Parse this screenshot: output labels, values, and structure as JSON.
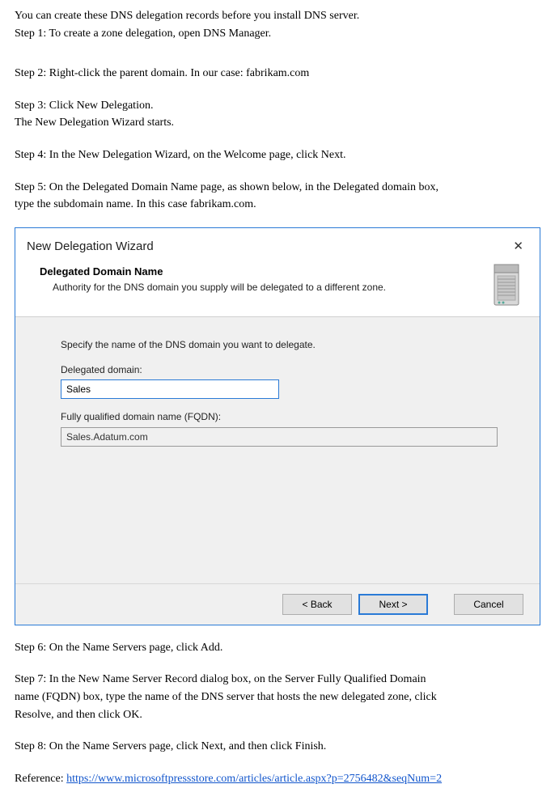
{
  "doc": {
    "intro_line1": "You can create these DNS delegation records before you install DNS server.",
    "step1": "Step 1: To create a zone delegation, open DNS Manager.",
    "step2": "Step 2: Right-click the parent domain. In our case: fabrikam.com",
    "step3a": "Step 3: Click New Delegation.",
    "step3b": "The New Delegation Wizard starts.",
    "step4": "Step 4: In the New Delegation Wizard, on the Welcome page, click Next.",
    "step5a": "Step 5: On the Delegated Domain Name page, as shown below, in the Delegated domain box,",
    "step5b": "type the subdomain name. In this case fabrikam.com.",
    "step6": "Step 6: On the Name Servers page, click Add.",
    "step7a": "Step 7: In the New Name Server Record dialog box, on the Server Fully Qualified Domain",
    "step7b": "name (FQDN) box, type the name of the DNS server that hosts the new delegated zone, click",
    "step7c": "Resolve, and then click OK.",
    "step8": "Step 8: On the Name Servers page, click Next, and then click Finish.",
    "ref_label": "Reference: ",
    "ref_url": "https://www.microsoftpressstore.com/articles/article.aspx?p=2756482&seqNum=2"
  },
  "wizard": {
    "title": "New Delegation Wizard",
    "close": "✕",
    "heading": "Delegated Domain Name",
    "sub": "Authority for the DNS domain you supply will be delegated to a different zone.",
    "instruction": "Specify the name of the DNS domain you want to delegate.",
    "delegated_label": "Delegated domain:",
    "delegated_value": "Sales",
    "fqdn_label": "Fully qualified domain name (FQDN):",
    "fqdn_value": "Sales.Adatum.com",
    "back": "< Back",
    "next": "Next >",
    "cancel": "Cancel"
  }
}
